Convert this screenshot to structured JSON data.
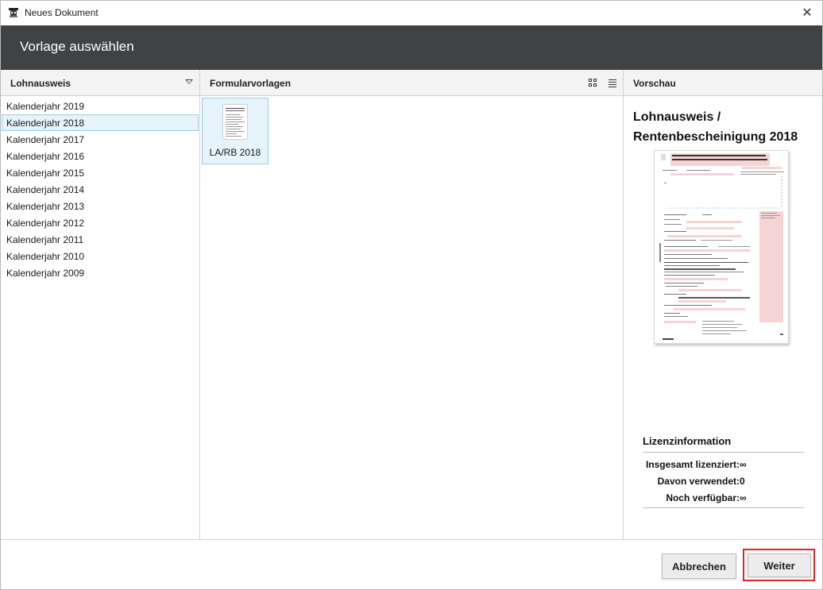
{
  "window": {
    "title": "Neues Dokument"
  },
  "header": {
    "title": "Vorlage auswählen"
  },
  "left_panel": {
    "title": "Lohnausweis",
    "items": [
      {
        "label": "Kalenderjahr 2019",
        "selected": false
      },
      {
        "label": "Kalenderjahr 2018",
        "selected": true
      },
      {
        "label": "Kalenderjahr 2017",
        "selected": false
      },
      {
        "label": "Kalenderjahr 2016",
        "selected": false
      },
      {
        "label": "Kalenderjahr 2015",
        "selected": false
      },
      {
        "label": "Kalenderjahr 2014",
        "selected": false
      },
      {
        "label": "Kalenderjahr 2013",
        "selected": false
      },
      {
        "label": "Kalenderjahr 2012",
        "selected": false
      },
      {
        "label": "Kalenderjahr 2011",
        "selected": false
      },
      {
        "label": "Kalenderjahr 2010",
        "selected": false
      },
      {
        "label": "Kalenderjahr 2009",
        "selected": false
      }
    ]
  },
  "middle_panel": {
    "title": "Formularvorlagen",
    "templates": [
      {
        "label": "LA/RB 2018",
        "selected": true
      }
    ]
  },
  "preview_panel": {
    "title": "Vorschau",
    "document_title": "Lohnausweis / Rentenbescheinigung 2018",
    "license": {
      "title": "Lizenzinformation",
      "rows": [
        {
          "label": "Insgesamt lizenziert:",
          "value": "∞"
        },
        {
          "label": "Davon verwendet:",
          "value": "0"
        },
        {
          "label": "Noch verfügbar:",
          "value": "∞"
        }
      ]
    }
  },
  "footer": {
    "cancel_label": "Abbrechen",
    "next_label": "Weiter"
  },
  "colors": {
    "header_bg": "#404244",
    "selection_bg": "#e5f3fb",
    "selection_border": "#9ccde9",
    "highlight_frame": "#d9262b",
    "form_pink": "#f6d3d5"
  }
}
